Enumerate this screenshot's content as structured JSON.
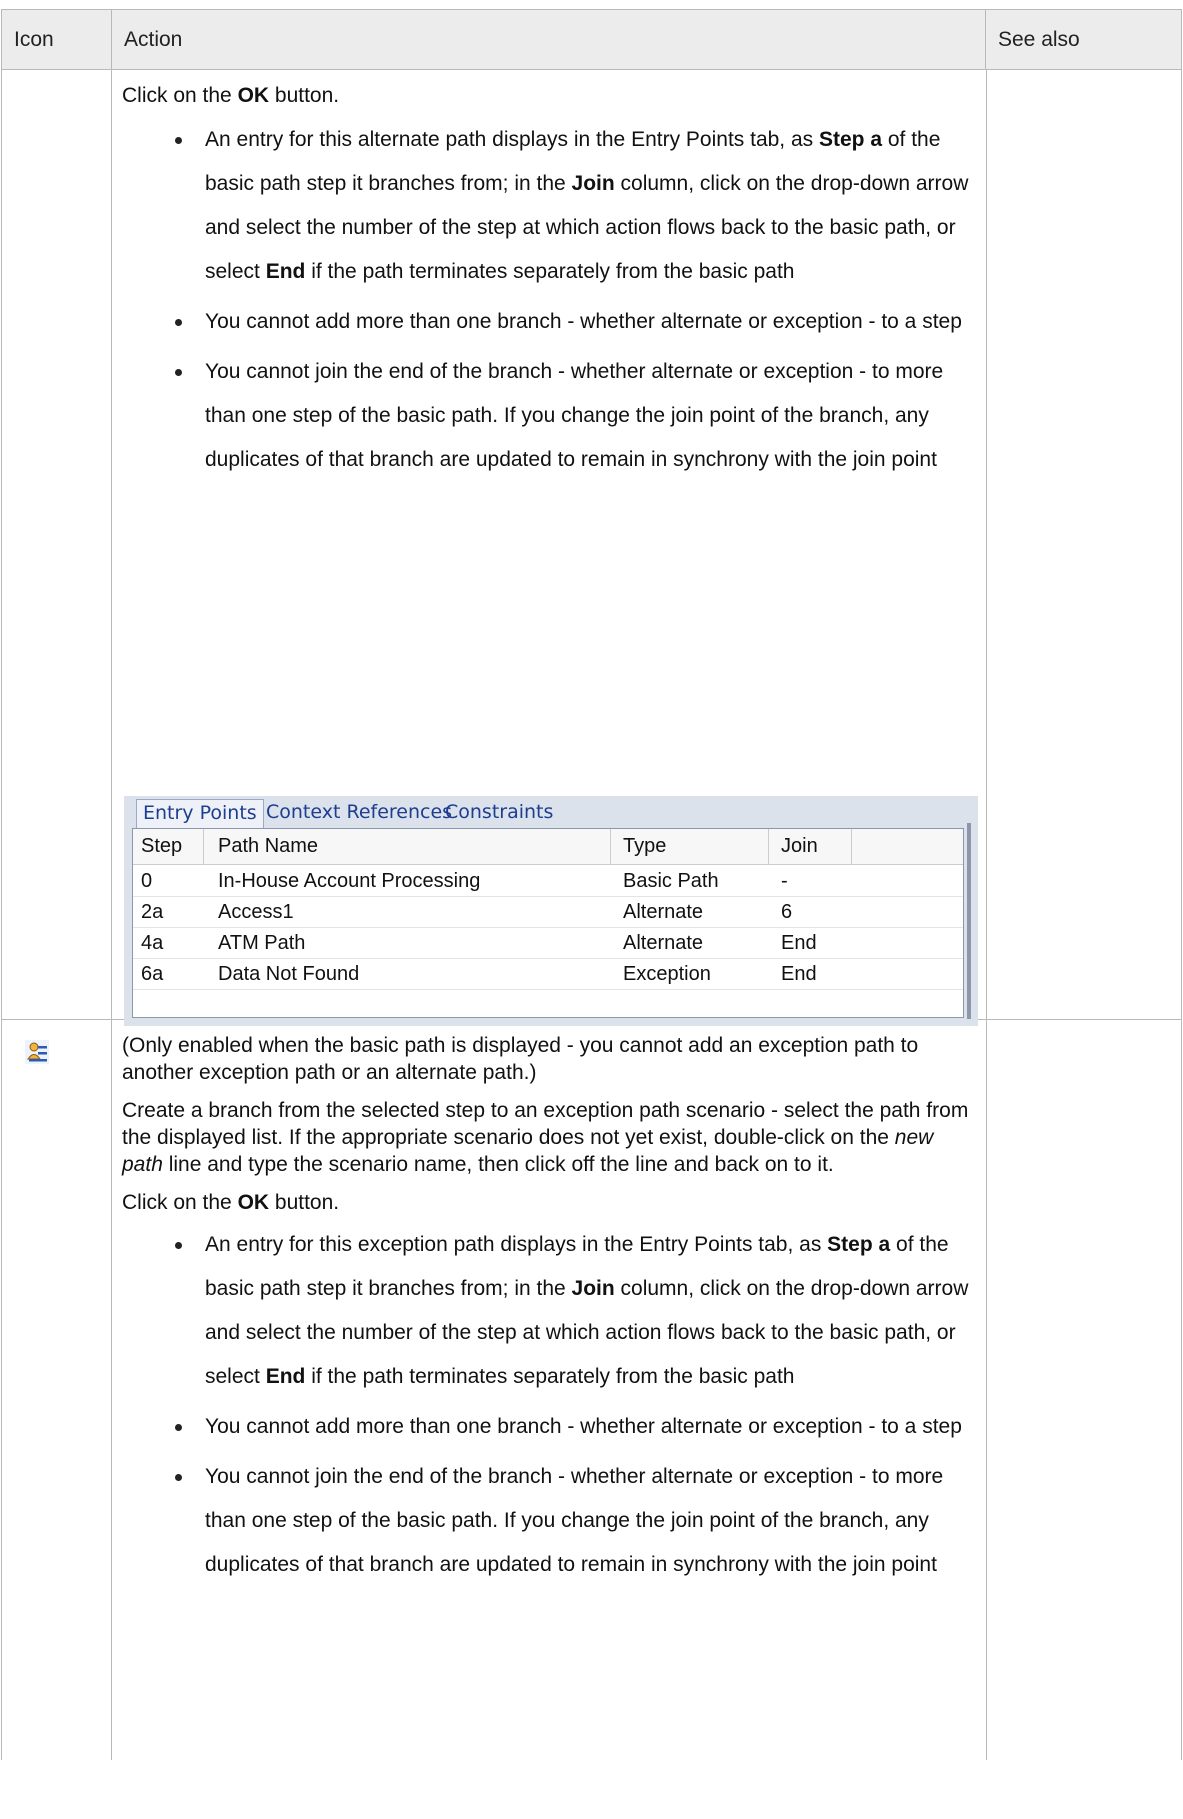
{
  "header": {
    "icon": "Icon",
    "action": "Action",
    "see_also": "See also"
  },
  "row1": {
    "click_ok": {
      "pre": "Click on the ",
      "bold": "OK",
      "post": " button."
    },
    "bullets": [
      {
        "segments": [
          {
            "t": "An entry for this alternate path displays in the Entry Points tab, as ",
            "b": false
          },
          {
            "t": "Step a",
            "b": true
          },
          {
            "t": " of the basic path step it branches from; in the ",
            "b": false
          },
          {
            "t": "Join",
            "b": true
          },
          {
            "t": " column, click on the drop-down arrow and select the number of the step at which action flows back to the basic path, or select ",
            "b": false
          },
          {
            "t": "End",
            "b": true
          },
          {
            "t": " if the path terminates separately from the basic path",
            "b": false
          }
        ]
      },
      {
        "segments": [
          {
            "t": "You cannot add more than one branch - whether alternate or exception - to a step",
            "b": false
          }
        ]
      },
      {
        "segments": [
          {
            "t": "You cannot join the end of the branch - whether alternate or exception - to more than one step of the basic path. If you change the join point of the branch, any duplicates of that branch are updated to remain in synchrony with the join point",
            "b": false
          }
        ]
      }
    ],
    "panel": {
      "tabs": [
        "Entry Points",
        "Context References",
        "Constraints"
      ],
      "columns": [
        "Step",
        "Path Name",
        "Type",
        "Join"
      ],
      "rows": [
        [
          "0",
          "In-House Account Processing",
          "Basic Path",
          "-"
        ],
        [
          "2a",
          "Access1",
          "Alternate",
          "6"
        ],
        [
          "4a",
          "ATM Path",
          "Alternate",
          "End"
        ],
        [
          "6a",
          "Data Not Found",
          "Exception",
          "End"
        ]
      ]
    }
  },
  "row2": {
    "icon": "exception-path-icon",
    "para1": "(Only enabled when the basic path is displayed - you cannot add an exception path to another exception path or an alternate path.)",
    "para2": {
      "pre": "Create a branch from the selected step to an exception path scenario - select the path from the displayed list. If the appropriate scenario does not yet exist, double-click on the ",
      "italic": "new path",
      "post": " line and type the scenario name, then click off the line and back on to it."
    },
    "click_ok": {
      "pre": "Click on the ",
      "bold": "OK",
      "post": " button."
    },
    "bullets": [
      {
        "segments": [
          {
            "t": "An entry for this exception path displays in the Entry Points tab, as ",
            "b": false
          },
          {
            "t": "Step a",
            "b": true
          },
          {
            "t": " of the basic path step it branches from; in the ",
            "b": false
          },
          {
            "t": "Join",
            "b": true
          },
          {
            "t": " column, click on the drop-down arrow and select the number of the step at which action flows back to the basic path, or select ",
            "b": false
          },
          {
            "t": "End",
            "b": true
          },
          {
            "t": " if the path terminates separately from the basic path",
            "b": false
          }
        ]
      },
      {
        "segments": [
          {
            "t": "You cannot add more than one branch - whether alternate or exception - to a step",
            "b": false
          }
        ]
      },
      {
        "segments": [
          {
            "t": "You cannot join the end of the branch - whether alternate or exception - to more than one step of the basic path. If you change the join point of the branch, any duplicates of that branch are updated to remain in synchrony with the join point",
            "b": false
          }
        ]
      }
    ]
  },
  "colors": {
    "border": "#b9b9b9",
    "header_bg": "#ececec",
    "tab_text": "#1e3d8f",
    "panel_bg": "#dbe2ec"
  }
}
